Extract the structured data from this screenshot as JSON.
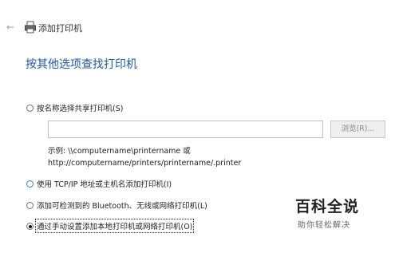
{
  "window": {
    "title": "添加打印机"
  },
  "heading": "按其他选项查找打印机",
  "options": [
    {
      "label": "按名称选择共享打印机(S)",
      "selected": false
    },
    {
      "label": "使用 TCP/IP 地址或主机名添加打印机(I)",
      "selected": false
    },
    {
      "label": "添加可检测到的 Bluetooth、无线或网络打印机(L)",
      "selected": false
    },
    {
      "label": "通过手动设置添加本地打印机或网络打印机(O)",
      "selected": true
    }
  ],
  "share_input": {
    "value": "",
    "placeholder": ""
  },
  "browse_label": "浏览(R)...",
  "example_line1": "示例: \\\\computername\\printername 或",
  "example_line2": "http://computername/printers/printername/.printer",
  "watermark": {
    "big": "百科全说",
    "small": "助你轻松解决"
  },
  "icons": {
    "back": "back-arrow-icon",
    "printer": "printer-icon",
    "logo": "baike-logo-icon"
  }
}
